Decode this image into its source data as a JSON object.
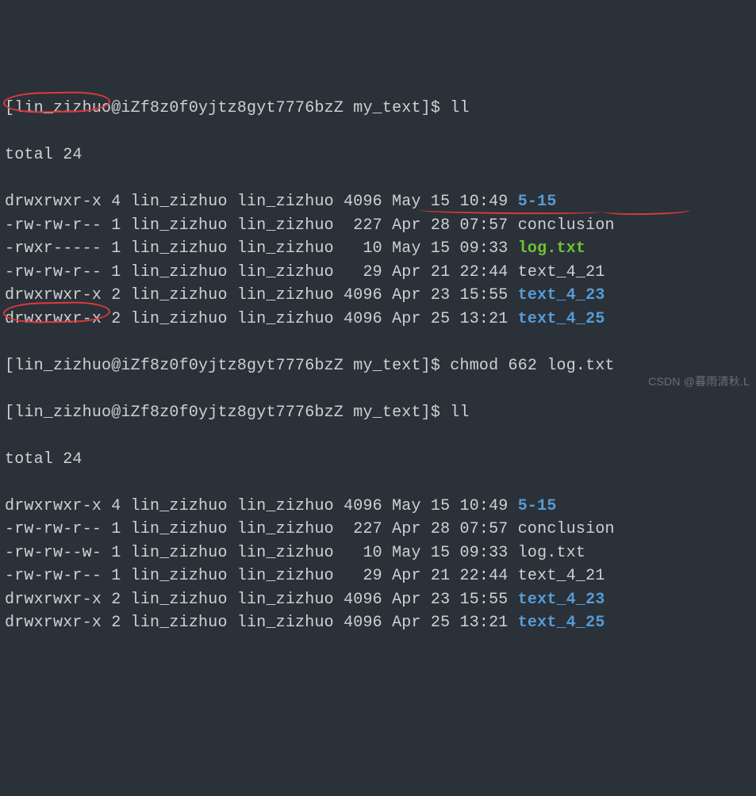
{
  "watermark": "CSDN @暮雨清秋.L",
  "prompt1": "[lin_zizhuo@iZf8z0f0yjtz8gyt7776bzZ my_text]$ ",
  "cmd1": "ll",
  "total1": "total 24",
  "ls1": [
    {
      "perm": "drwxrwxr-x",
      "links": "4",
      "owner": "lin_zizhuo",
      "group": "lin_zizhuo",
      "size": "4096",
      "date": "May 15 10:49",
      "name": "5-15",
      "cls": "blue"
    },
    {
      "perm": "-rw-rw-r--",
      "links": "1",
      "owner": "lin_zizhuo",
      "group": "lin_zizhuo",
      "size": " 227",
      "date": "Apr 28 07:57",
      "name": "conclusion",
      "cls": ""
    },
    {
      "perm": "-rwxr-----",
      "links": "1",
      "owner": "lin_zizhuo",
      "group": "lin_zizhuo",
      "size": "  10",
      "date": "May 15 09:33",
      "name": "log.txt",
      "cls": "green"
    },
    {
      "perm": "-rw-rw-r--",
      "links": "1",
      "owner": "lin_zizhuo",
      "group": "lin_zizhuo",
      "size": "  29",
      "date": "Apr 21 22:44",
      "name": "text_4_21",
      "cls": ""
    },
    {
      "perm": "drwxrwxr-x",
      "links": "2",
      "owner": "lin_zizhuo",
      "group": "lin_zizhuo",
      "size": "4096",
      "date": "Apr 23 15:55",
      "name": "text_4_23",
      "cls": "blue"
    },
    {
      "perm": "drwxrwxr-x",
      "links": "2",
      "owner": "lin_zizhuo",
      "group": "lin_zizhuo",
      "size": "4096",
      "date": "Apr 25 13:21",
      "name": "text_4_25",
      "cls": "blue"
    }
  ],
  "prompt2": "[lin_zizhuo@iZf8z0f0yjtz8gyt7776bzZ my_text]$ ",
  "cmd2": "chmod 662 log.txt",
  "prompt3": "[lin_zizhuo@iZf8z0f0yjtz8gyt7776bzZ my_text]$ ",
  "cmd3": "ll",
  "total2": "total 24",
  "ls2": [
    {
      "perm": "drwxrwxr-x",
      "links": "4",
      "owner": "lin_zizhuo",
      "group": "lin_zizhuo",
      "size": "4096",
      "date": "May 15 10:49",
      "name": "5-15",
      "cls": "blue"
    },
    {
      "perm": "-rw-rw-r--",
      "links": "1",
      "owner": "lin_zizhuo",
      "group": "lin_zizhuo",
      "size": " 227",
      "date": "Apr 28 07:57",
      "name": "conclusion",
      "cls": ""
    },
    {
      "perm": "-rw-rw--w-",
      "links": "1",
      "owner": "lin_zizhuo",
      "group": "lin_zizhuo",
      "size": "  10",
      "date": "May 15 09:33",
      "name": "log.txt",
      "cls": ""
    },
    {
      "perm": "-rw-rw-r--",
      "links": "1",
      "owner": "lin_zizhuo",
      "group": "lin_zizhuo",
      "size": "  29",
      "date": "Apr 21 22:44",
      "name": "text_4_21",
      "cls": ""
    },
    {
      "perm": "drwxrwxr-x",
      "links": "2",
      "owner": "lin_zizhuo",
      "group": "lin_zizhuo",
      "size": "4096",
      "date": "Apr 23 15:55",
      "name": "text_4_23",
      "cls": "blue"
    },
    {
      "perm": "drwxrwxr-x",
      "links": "2",
      "owner": "lin_zizhuo",
      "group": "lin_zizhuo",
      "size": "4096",
      "date": "Apr 25 13:21",
      "name": "text_4_25",
      "cls": "blue"
    }
  ]
}
